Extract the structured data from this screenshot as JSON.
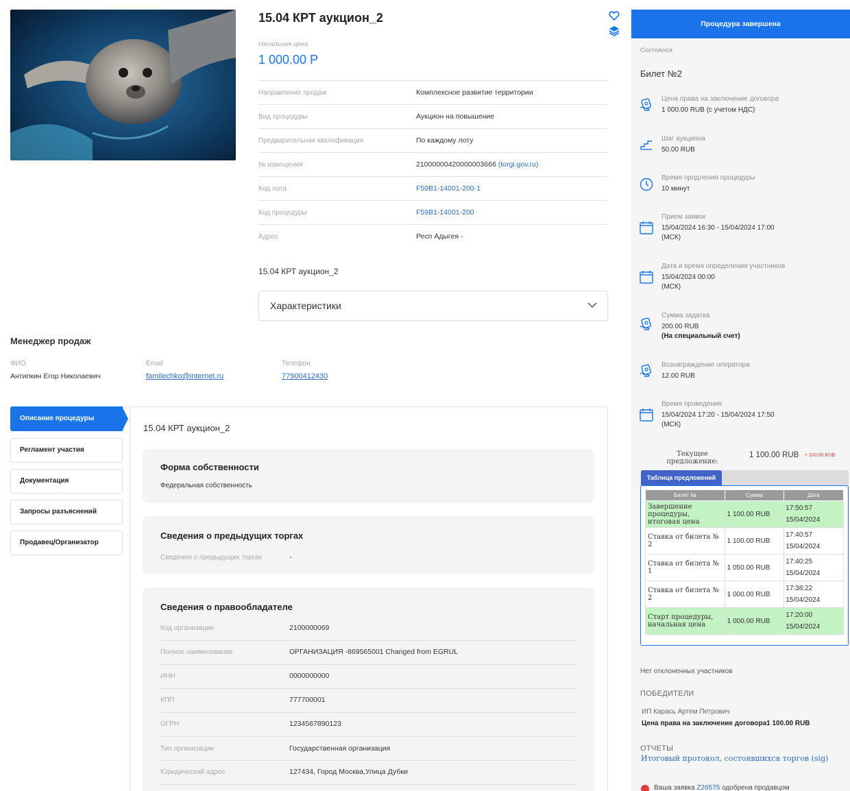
{
  "lot": {
    "title": "15.04 КРТ аукцион_2",
    "start_price_label": "Начальная цена",
    "start_price": "1 000.00 Р",
    "details": [
      {
        "label": "Направление продаж",
        "value": "Комплексное развитие территории"
      },
      {
        "label": "Вид процедуры",
        "value": "Аукцион на повышение"
      },
      {
        "label": "Предварительная квалификация",
        "value": "По каждому лоту"
      },
      {
        "label": "№ извещения",
        "value": "21000000420000003666",
        "link": "(torgi.gov.ru)"
      },
      {
        "label": "Код лота",
        "value": "F59B1-14001-200-1"
      },
      {
        "label": "Код процедуры",
        "value": "F59B1-14001-200"
      },
      {
        "label": "Адрес",
        "value": "Респ Адыгея -"
      }
    ],
    "subtitle": "15.04 КРТ аукцион_2",
    "characteristics_label": "Характеристики"
  },
  "manager": {
    "heading": "Менеджер продаж",
    "name_label": "ФИО",
    "name": "Антипкин Егор Николаевич",
    "email_label": "Email",
    "email": "familechko@internet.ru",
    "phone_label": "Телефон",
    "phone": "77900412430"
  },
  "tabs": [
    {
      "label": "Описание процедуры",
      "active": true
    },
    {
      "label": "Регламент участия",
      "active": false
    },
    {
      "label": "Документация",
      "active": false
    },
    {
      "label": "Запросы разъяснений",
      "active": false
    },
    {
      "label": "Продавец/Организатор",
      "active": false
    }
  ],
  "description": {
    "title": "15.04 КРТ аукцион_2",
    "ownership": {
      "title": "Форма собственности",
      "value": "Федеральная собственность"
    },
    "previous": {
      "title": "Сведения о предыдущих торгах",
      "label": "Сведения о предыдущих торгах",
      "value": "-"
    },
    "holder": {
      "title": "Сведения о правообладателе",
      "rows": [
        {
          "label": "Код организации",
          "value": "2100000069"
        },
        {
          "label": "Полное наименование",
          "value": "ОРГАНИЗАЦИЯ -869565001 Changed from EGRUL"
        },
        {
          "label": "ИНН",
          "value": "0000000000"
        },
        {
          "label": "КПП",
          "value": "777700001"
        },
        {
          "label": "ОГРН",
          "value": "1234567890123"
        },
        {
          "label": "Тип организации",
          "value": "Государственная организация"
        },
        {
          "label": "Юридический адрес",
          "value": "127434, Город Москва,Улица Дубки"
        }
      ]
    }
  },
  "procedure": {
    "status": "Процедура завершена",
    "state": "Состоялся",
    "ticket": "Билет №2",
    "items": [
      {
        "icon": "money-hand-icon",
        "label": "Цена права на заключение договора",
        "value": "1 000.00 RUB (с учетом НДС)"
      },
      {
        "icon": "stairs-step-icon",
        "label": "Шаг аукциона",
        "value": "50.00 RUB"
      },
      {
        "icon": "clock-icon",
        "label": "Время продления процедуры",
        "value": "10 минут"
      },
      {
        "icon": "calendar-icon",
        "label": "Прием заявок",
        "value": "15/04/2024 16:30  - 15/04/2024 17:00",
        "value2": "(МСК)"
      },
      {
        "icon": "calendar-icon",
        "label": "Дата и время определения участников",
        "value": "15/04/2024 00:00",
        "value2": "(МСК)"
      },
      {
        "icon": "money-hand-icon",
        "label": "Сумма задатка",
        "value": "200.00 RUB",
        "value2": "(На специальный счет)"
      },
      {
        "icon": "money-hand-icon",
        "label": "Вознаграждение оператора",
        "value": "12.00 RUB"
      },
      {
        "icon": "calendar-icon",
        "label": "Время проведения",
        "value": "15/04/2024 17:20 - 15/04/2024 17:50",
        "value2": "(МСК)"
      }
    ],
    "current_offer_label": "Текущее предложение:",
    "current_offer": "1 100.00 RUB",
    "current_offer_delta": "+ 100.00 RUB",
    "bids_tab": "Таблица предложений",
    "bids_headers": [
      "Билет №",
      "Сумма",
      "Дата"
    ],
    "bids": [
      {
        "event": "Завершение процедуры, итоговая цена",
        "sum": "1 100.00 RUB",
        "time": "17:50:57",
        "date": "15/04/2024",
        "highlight": true
      },
      {
        "event": "Ставка от билета № 2",
        "sum": "1 100.00 RUB",
        "time": "17:40:57",
        "date": "15/04/2024",
        "highlight": false
      },
      {
        "event": "Ставка от билета № 1",
        "sum": "1 050.00 RUB",
        "time": "17:40:25",
        "date": "15/04/2024",
        "highlight": false
      },
      {
        "event": "Ставка от билета № 2",
        "sum": "1 000.00 RUB",
        "time": "17:38:22",
        "date": "15/04/2024",
        "highlight": false
      },
      {
        "event": "Старт процедуры, начальная цена",
        "sum": "1 000.00 RUB",
        "time": "17:20:00",
        "date": "15/04/2024",
        "highlight": true
      }
    ],
    "no_rejected": "Нет отклоненных участников",
    "winners_heading": "ПОБЕДИТЕЛИ",
    "winner_name": "ИП Карась Артем Петрович",
    "winner_price": "Цена права на заключение договора1 100.00 RUB",
    "reports_heading": "ОТЧЕТЫ",
    "report_link": "Итоговый протокол, состоявшихся торгов (sig)",
    "notice_prefix": "Ваша заявка",
    "notice_link": "Z26575",
    "notice_suffix": "одобрена продавцом"
  },
  "colors": {
    "accent": "#1a73e8",
    "price": "#1a73e8",
    "green": "#c3f2c3",
    "delta": "#e23b3b"
  }
}
